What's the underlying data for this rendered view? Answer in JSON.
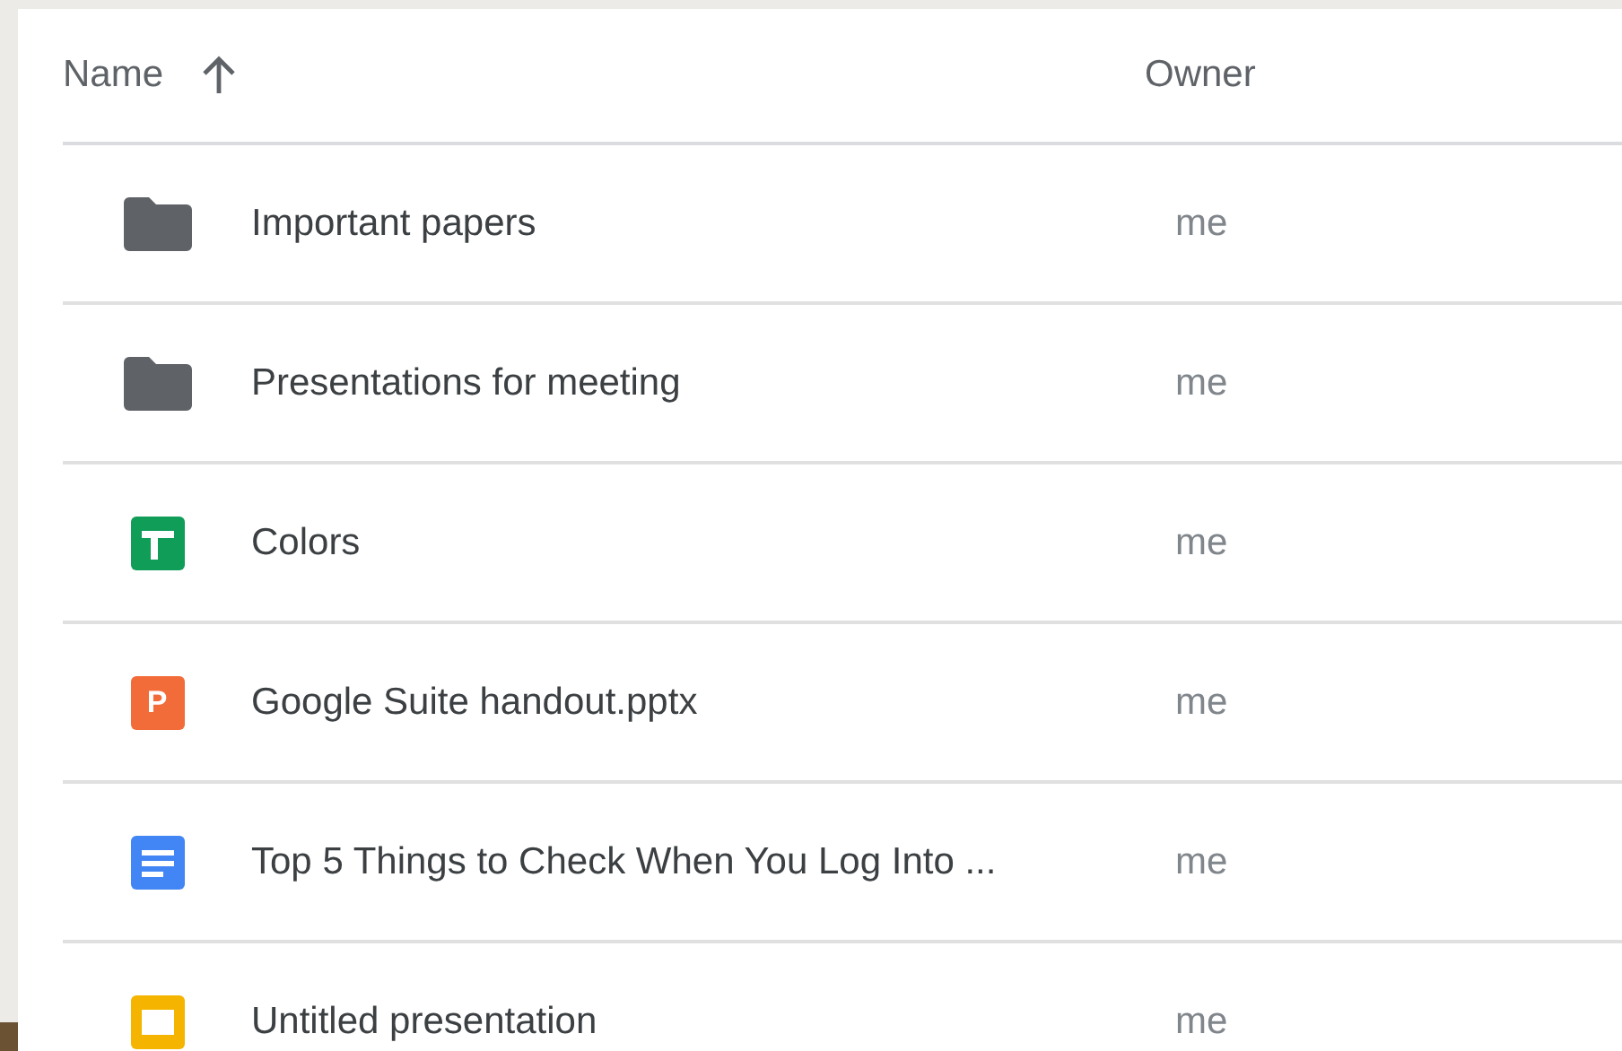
{
  "table": {
    "columns": [
      {
        "label": "Name"
      },
      {
        "label": "Owner"
      }
    ],
    "rows": [
      {
        "kind": "folder",
        "name": "Important papers",
        "owner": "me"
      },
      {
        "kind": "folder",
        "name": "Presentations for meeting",
        "owner": "me"
      },
      {
        "kind": "sheet",
        "name": "Colors",
        "owner": "me"
      },
      {
        "kind": "pptx",
        "icon_letter": "P",
        "name": "Google Suite handout.pptx",
        "owner": "me"
      },
      {
        "kind": "doc",
        "name": "Top 5 Things to Check When You Log Into ...",
        "owner": "me"
      },
      {
        "kind": "slides",
        "name": "Untitled presentation",
        "owner": "me"
      }
    ]
  }
}
